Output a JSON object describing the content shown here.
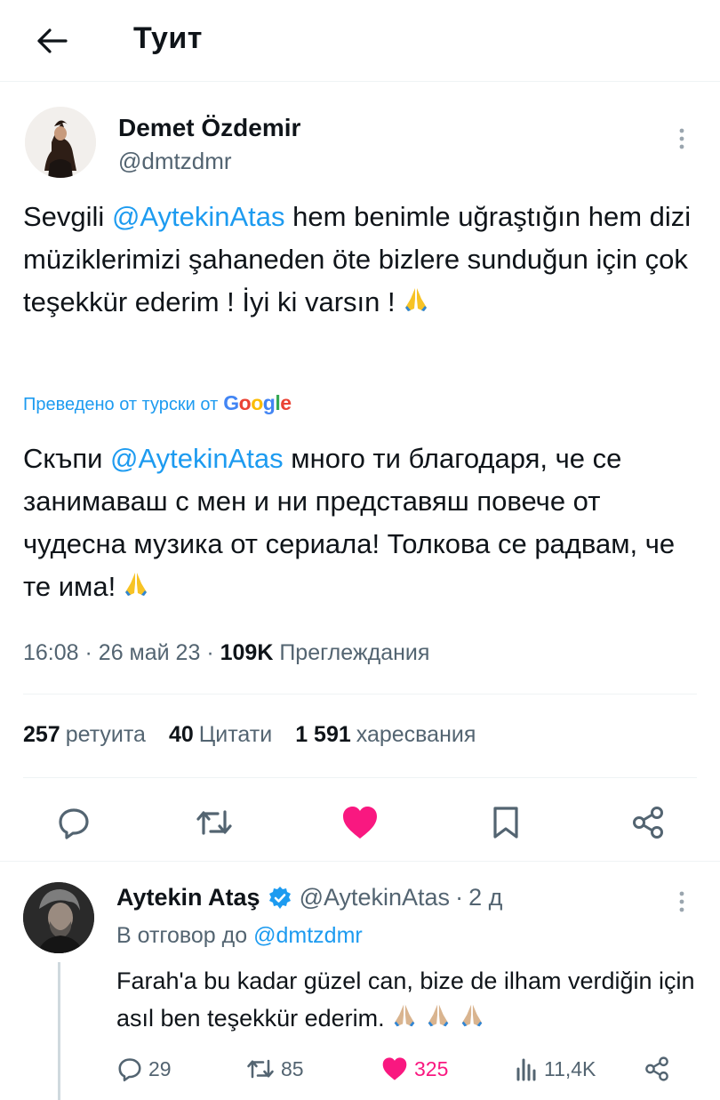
{
  "header": {
    "title": "Туит"
  },
  "tweet": {
    "author_name": "Demet Özdemir",
    "author_handle": "@dmtzdmr",
    "original": {
      "before": "Sevgili ",
      "mention": "@AytekinAtas",
      "after": " hem benimle uğraştığın hem dizi müziklerimizi şahaneden öte bizlere sunduğun için çok teşekkür ederim ! İyi ki varsın !"
    },
    "translation_note": "Преведено от турски от",
    "translation_provider": "Google",
    "translated": {
      "before": "Скъпи ",
      "mention": "@AytekinAtas",
      "after": " много ти благодаря, че се занимаваш с мен и ни представяш повече от чудесна музика от сериала! Толкова се радвам, че те има!"
    },
    "time": "16:08",
    "date": "26 май 23",
    "views_count": "109K",
    "views_label": "Преглеждания",
    "retweets_count": "257",
    "retweets_label": "ретуита",
    "quotes_count": "40",
    "quotes_label": "Цитати",
    "likes_count": "1 591",
    "likes_label": "харесвания"
  },
  "reply": {
    "author_name": "Aytekin Ataş",
    "author_handle": "@AytekinAtas",
    "age": "2 д",
    "reply_to_label": "В отговор до",
    "reply_to_handle": "@dmtzdmr",
    "text": "Farah'a bu kadar güzel can, bize de ilham verdiğin için asıl ben teşekkür ederim.",
    "replies": "29",
    "retweets": "85",
    "likes": "325",
    "views": "11,4K"
  },
  "colors": {
    "accent": "#1d9bf0",
    "like": "#f91880",
    "muted": "#536471",
    "verified": "#1d9bf0"
  },
  "icons": [
    "back-arrow-icon",
    "more-icon",
    "reply-icon",
    "retweet-icon",
    "heart-icon",
    "bookmark-icon",
    "share-icon",
    "verified-icon",
    "views-icon",
    "pray-emoji"
  ]
}
